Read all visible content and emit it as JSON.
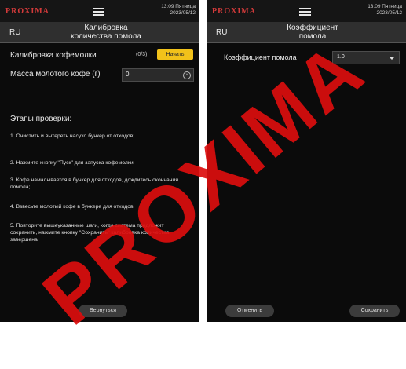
{
  "status": {
    "brand": "PROXIMA",
    "time": "13:09 Пятница",
    "date": "2023/05/12"
  },
  "left": {
    "lang": "RU",
    "title_line1": "Калибровка",
    "title_line2": "количества помола",
    "calibration_label": "Калибровка кофемолки",
    "calibration_count": "(0/3)",
    "start_button": "Начать",
    "mass_label": "Масса молотого кофе (г)",
    "mass_value": "0",
    "steps_title": "Этапы проверки:",
    "steps": [
      "1. Очистить и вытереть насухо бункер от отходов;",
      "2. Нажмите кнопку \"Пуск\" для запуска кофемолки;",
      "3. Кофе намалывается в бункер для отходов, дождитесь окончания помола;",
      "4. Взвесьте молотый кофе в бункере для отходов;",
      "5. Повторите вышеуказанные шаги, когда система предложит сохранить, нажмите кнопку \"Сохранить\" калибровка количества завершена."
    ],
    "back_button": "Вернуться"
  },
  "right": {
    "lang": "RU",
    "title_line1": "Коэффициент",
    "title_line2": "помола",
    "coef_label": "Коэффициент помола",
    "coef_value": "1.0",
    "cancel_button": "Отменить",
    "save_button": "Сохранить"
  },
  "watermark": "PROXIMA",
  "colors": {
    "accent_yellow": "#f2c21a",
    "brand_red": "#d33a3a",
    "watermark_red": "#dc0e0e",
    "background": "#0b0b0b"
  }
}
